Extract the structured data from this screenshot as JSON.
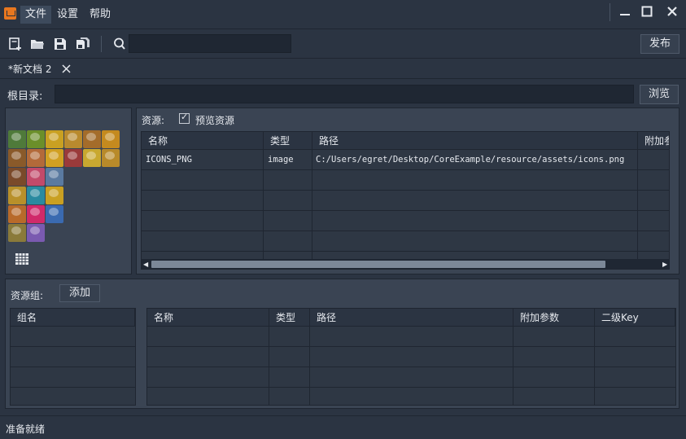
{
  "menu": {
    "file": "文件",
    "settings": "设置",
    "help": "帮助"
  },
  "window_controls": {
    "minimize": "—",
    "maximize": "☐",
    "close": "✕"
  },
  "toolbar": {
    "publish_label": "发布",
    "search_value": ""
  },
  "tab": {
    "label": "*新文档 2",
    "close": "✕"
  },
  "root": {
    "label": "根目录:",
    "value": "",
    "browse_label": "浏览"
  },
  "resources": {
    "label": "资源:",
    "preview_label": "预览资源",
    "preview_checked": true,
    "columns": [
      "名称",
      "类型",
      "路径",
      "附加参"
    ],
    "rows": [
      {
        "name": "ICONS_PNG",
        "type": "image",
        "path": "C:/Users/egret/Desktop/CoreExample/resource/assets/icons.png",
        "extra": ""
      }
    ]
  },
  "groups": {
    "label": "资源组:",
    "add_label": "添加",
    "group_columns": [
      "组名"
    ],
    "detail_columns": [
      "名称",
      "类型",
      "路径",
      "附加参数",
      "二级Key"
    ]
  },
  "status": {
    "text": "准备就绪"
  },
  "colors": {
    "accent": "#e8771f",
    "background": "#2b3442",
    "panel": "#3a4453"
  }
}
